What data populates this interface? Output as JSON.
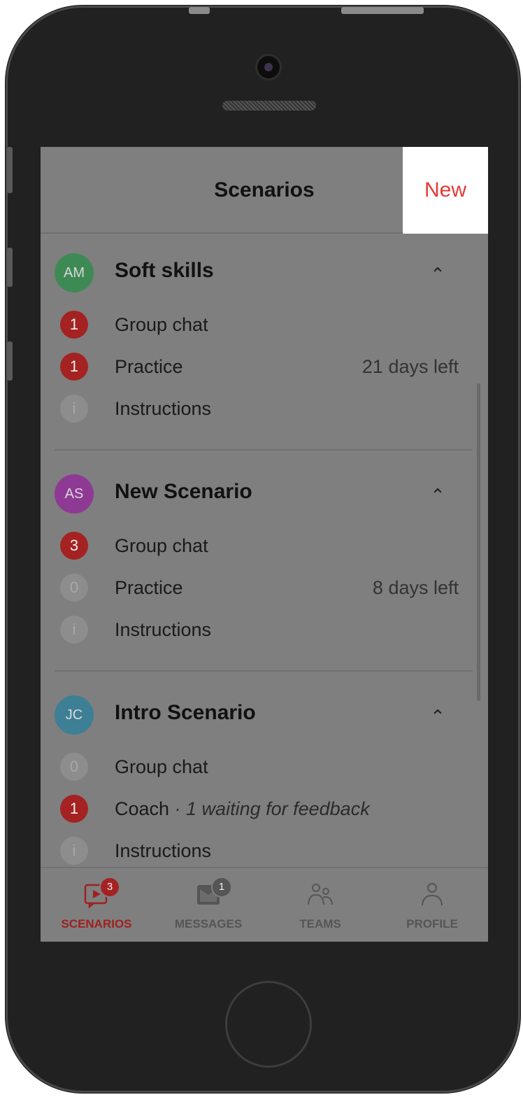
{
  "header": {
    "title": "Scenarios",
    "new_label": "New"
  },
  "sections": [
    {
      "initials": "AM",
      "avatar_color": "#3e8a55",
      "title": "Soft skills",
      "rows": [
        {
          "badge": "1",
          "badge_style": "red",
          "label": "Group chat",
          "note": "",
          "right": ""
        },
        {
          "badge": "1",
          "badge_style": "red",
          "label": "Practice",
          "note": "",
          "right": "21 days left"
        },
        {
          "badge": "i",
          "badge_style": "grey",
          "label": "Instructions",
          "note": "",
          "right": ""
        }
      ]
    },
    {
      "initials": "AS",
      "avatar_color": "#8e3a95",
      "title": "New Scenario",
      "rows": [
        {
          "badge": "3",
          "badge_style": "red",
          "label": "Group chat",
          "note": "",
          "right": ""
        },
        {
          "badge": "0",
          "badge_style": "grey",
          "label": "Practice",
          "note": "",
          "right": "8 days left"
        },
        {
          "badge": "i",
          "badge_style": "grey",
          "label": "Instructions",
          "note": "",
          "right": ""
        }
      ]
    },
    {
      "initials": "JC",
      "avatar_color": "#3d7f95",
      "title": "Intro Scenario",
      "rows": [
        {
          "badge": "0",
          "badge_style": "grey",
          "label": "Group chat",
          "note": "",
          "right": ""
        },
        {
          "badge": "1",
          "badge_style": "red",
          "label": "Coach",
          "note": " · 1 waiting for feedback",
          "right": ""
        },
        {
          "badge": "i",
          "badge_style": "grey",
          "label": "Instructions",
          "note": "",
          "right": ""
        }
      ]
    }
  ],
  "tabs": [
    {
      "label": "SCENARIOS",
      "icon": "scenarios-icon",
      "badge": "3",
      "active": true
    },
    {
      "label": "MESSAGES",
      "icon": "messages-icon",
      "badge": "1",
      "active": false
    },
    {
      "label": "TEAMS",
      "icon": "teams-icon",
      "badge": "",
      "active": false
    },
    {
      "label": "PROFILE",
      "icon": "profile-icon",
      "badge": "",
      "active": false
    }
  ],
  "colors": {
    "accent_red": "#e53935",
    "badge_red": "#a52222",
    "active_tab": "#a02020"
  }
}
